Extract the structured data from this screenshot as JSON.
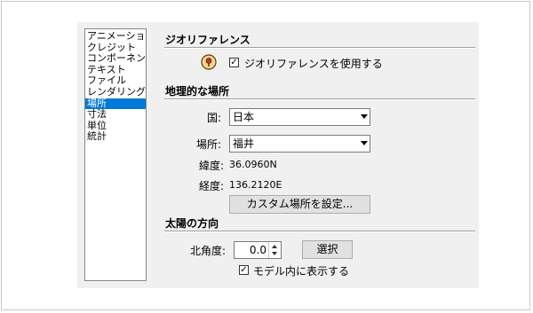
{
  "sidebar": {
    "items": [
      {
        "label": "アニメーション"
      },
      {
        "label": "クレジット"
      },
      {
        "label": "コンポーネント"
      },
      {
        "label": "テキスト"
      },
      {
        "label": "ファイル"
      },
      {
        "label": "レンダリング"
      },
      {
        "label": "場所",
        "selected": true
      },
      {
        "label": "寸法"
      },
      {
        "label": "単位"
      },
      {
        "label": "統計"
      }
    ]
  },
  "georef": {
    "title": "ジオリファレンス",
    "checkbox_label": "ジオリファレンスを使用する",
    "checked": true,
    "icon": "geo-pin-icon"
  },
  "location": {
    "title": "地理的な場所",
    "country_label": "国:",
    "country_value": "日本",
    "place_label": "場所:",
    "place_value": "福井",
    "latitude_label": "緯度:",
    "latitude_value": "36.0960N",
    "longitude_label": "経度:",
    "longitude_value": "136.2120E",
    "custom_button": "カスタム場所を設定..."
  },
  "sun": {
    "title": "太陽の方向",
    "north_label": "北角度:",
    "north_value": "0.0",
    "select_button": "選択",
    "show_checkbox_label": "モデル内に表示する",
    "show_checked": true
  },
  "colors": {
    "selection": "#0078d7",
    "dialog_bg": "#f0f0f0",
    "icon_red": "#c0392b"
  }
}
